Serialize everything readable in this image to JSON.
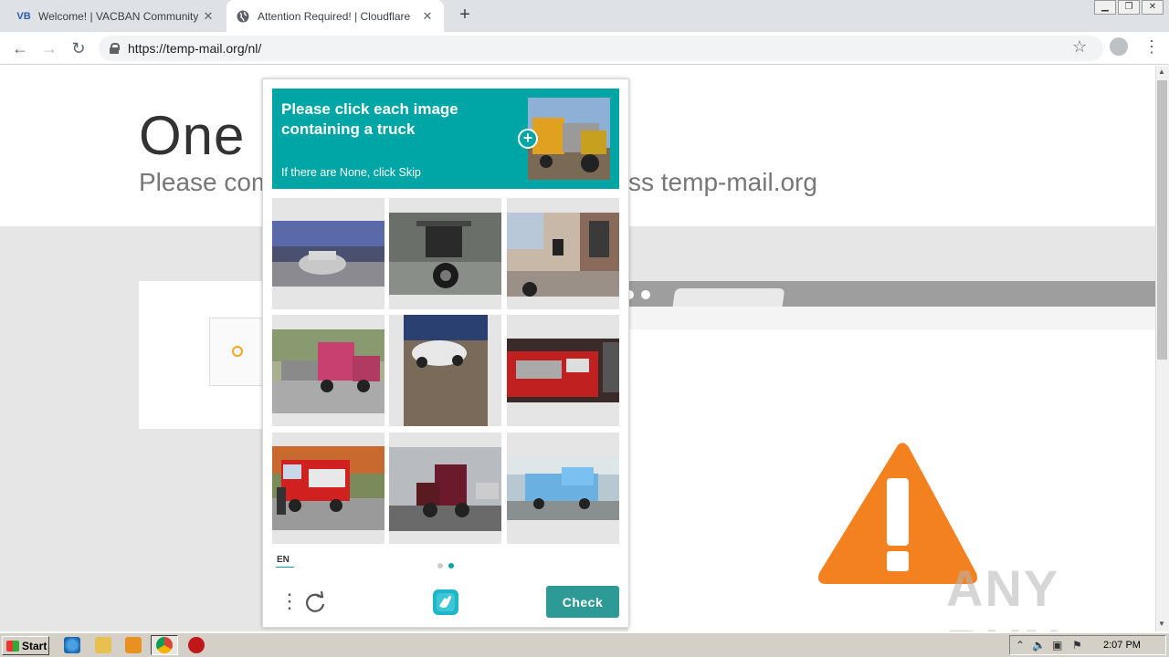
{
  "browser": {
    "tabs": [
      {
        "title": "Welcome! | VACBAN Community",
        "favicon": "VB"
      },
      {
        "title": "Attention Required! | Cloudflare",
        "favicon": "globe-icon"
      }
    ],
    "url": "https://temp-mail.org/nl/"
  },
  "page": {
    "heading": "One m",
    "subtitle": "Please com",
    "subtitle_tail": "ss temp-mail.org",
    "watermark": "ANY RUN"
  },
  "captcha": {
    "prompt": "Please click each image containing a truck",
    "hint": "If there are None, click Skip",
    "language": "EN",
    "check_label": "Check",
    "accent_color": "#00a5a5",
    "page_count": 2,
    "current_page": 2,
    "tiles": [
      {
        "subject": "silver sports car at auto show"
      },
      {
        "subject": "motorcycle"
      },
      {
        "subject": "motorcycle in alley"
      },
      {
        "subject": "pink semi truck"
      },
      {
        "subject": "white convertible car"
      },
      {
        "subject": "red fire truck engine"
      },
      {
        "subject": "red fire truck with firefighter"
      },
      {
        "subject": "dark red semi truck cab"
      },
      {
        "subject": "blue truck with trailer"
      }
    ]
  },
  "taskbar": {
    "start_label": "Start",
    "time": "2:07 PM"
  }
}
